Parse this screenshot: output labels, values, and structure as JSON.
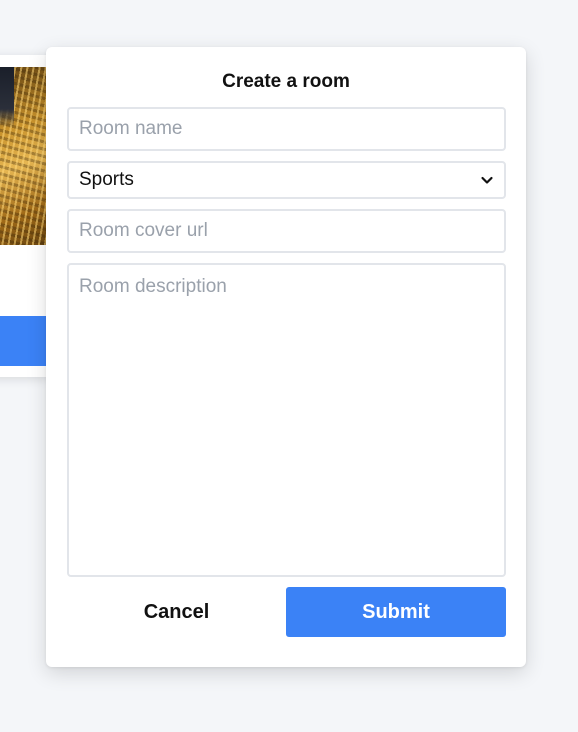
{
  "modal": {
    "title": "Create a room",
    "room_name_placeholder": "Room name",
    "category_selected": "Sports",
    "cover_url_placeholder": "Room cover url",
    "description_placeholder": "Room description",
    "cancel_label": "Cancel",
    "submit_label": "Submit"
  },
  "colors": {
    "accent": "#3b82f6",
    "background": "#f4f6f9",
    "field_border": "#e2e5ea"
  },
  "icons": {
    "select_chevron": "chevron-down-icon"
  }
}
